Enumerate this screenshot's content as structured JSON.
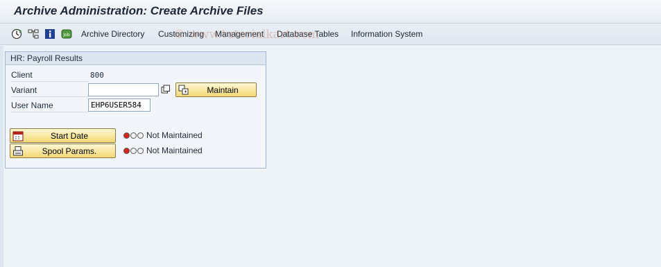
{
  "window": {
    "title": "Archive Administration: Create Archive Files"
  },
  "toolbar": {
    "icons": [
      "execute-clock-icon",
      "hierarchy-icon",
      "info-icon",
      "job-icon"
    ],
    "job_icon_text": "Job",
    "menu": [
      "Archive Directory",
      "Customizing",
      "Management",
      "Database Tables",
      "Information System"
    ]
  },
  "watermark": "© www.tutorialkart.com",
  "group": {
    "title": "HR: Payroll Results",
    "client_label": "Client",
    "client_value": "800",
    "variant_label": "Variant",
    "variant_value": "",
    "maintain_label": "Maintain",
    "user_label": "User Name",
    "user_value": "EHP6USER584",
    "start_date_label": "Start Date",
    "start_date_status": "Not Maintained",
    "spool_label": "Spool Params.",
    "spool_status": "Not Maintained"
  },
  "colors": {
    "light_red": "#d9221c",
    "light_off": "#f3f3f3",
    "button_gradient_top": "#fff8d4",
    "button_gradient_bottom": "#f3d876"
  }
}
